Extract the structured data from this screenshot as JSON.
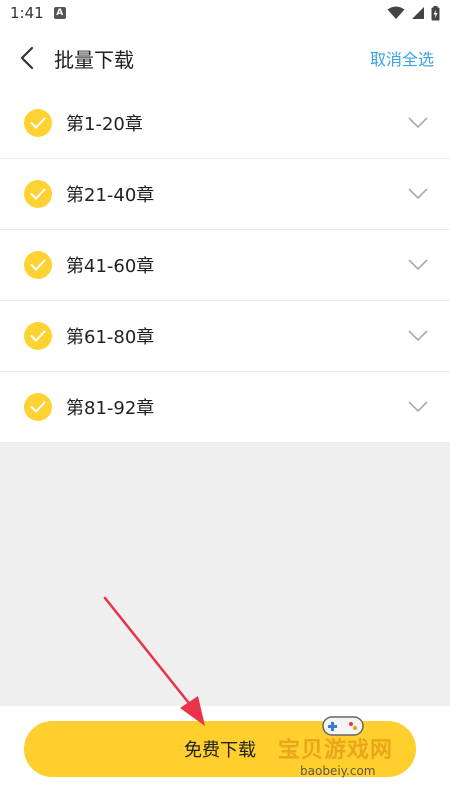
{
  "status_bar": {
    "time": "1:41",
    "notification_icon": "a-notification-icon",
    "icons": [
      "wifi-icon",
      "signal-icon",
      "battery-icon"
    ]
  },
  "header": {
    "title": "批量下载",
    "action_label": "取消全选",
    "back_icon": "chevron-left-icon"
  },
  "chapters": [
    {
      "label": "第1-20章",
      "checked": true
    },
    {
      "label": "第21-40章",
      "checked": true
    },
    {
      "label": "第41-60章",
      "checked": true
    },
    {
      "label": "第61-80章",
      "checked": true
    },
    {
      "label": "第81-92章",
      "checked": true
    }
  ],
  "footer": {
    "button_label": "免费下载"
  },
  "watermark": {
    "text": "宝贝游戏网",
    "domain": "baobeiy.com"
  },
  "colors": {
    "accent_yellow": "#ffcf2e",
    "check_yellow": "#ffd233",
    "link_blue": "#3aa3e3",
    "annotation_red": "#e8334a"
  }
}
